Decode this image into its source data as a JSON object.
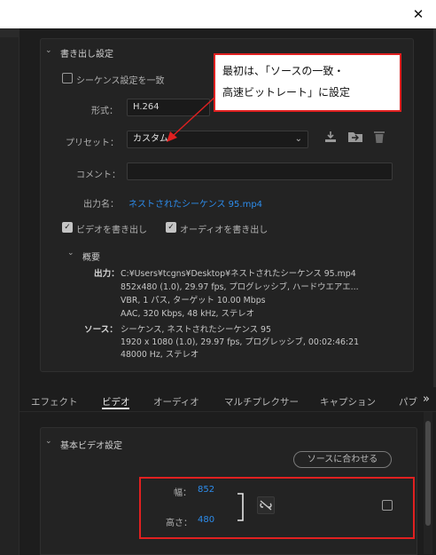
{
  "window": {
    "close_glyph": "✕"
  },
  "export": {
    "section_title": "書き出し設定",
    "match_sequence_label": "シーケンス設定を一致",
    "format_label": "形式：",
    "format_value": "H.264",
    "preset_label": "プリセット：",
    "preset_value": "カスタム",
    "comment_label": "コメント：",
    "comment_value": "",
    "output_name_label": "出力名：",
    "output_name_value": "ネストされたシーケンス 95.mp4",
    "export_video_label": "ビデオを書き出し",
    "export_audio_label": "オーディオを書き出し",
    "summary_title": "概要",
    "output_key": "出力：",
    "output_lines": [
      "C:¥Users¥tcgns¥Desktop¥ネストされたシーケンス 95.mp4",
      "852x480 (1.0), 29.97 fps, プログレッシブ, ハードウエアエ...",
      "VBR, 1 パス, ターゲット 10.00 Mbps",
      "AAC, 320 Kbps, 48 kHz, ステレオ"
    ],
    "source_key": "ソース：",
    "source_lines": [
      "シーケンス, ネストされたシーケンス 95",
      "1920 x 1080 (1.0), 29.97 fps, プログレッシブ, 00:02:46:21",
      "48000 Hz, ステレオ"
    ]
  },
  "callout": {
    "line1": "最初は、「ソースの一致・",
    "line2": "高速ビットレート」に設定"
  },
  "tabs": [
    "エフェクト",
    "ビデオ",
    "オーディオ",
    "マルチプレクサー",
    "キャプション",
    "パブ"
  ],
  "tabs_more_glyph": "»",
  "video": {
    "section_title": "基本ビデオ設定",
    "match_source_button": "ソースに合わせる",
    "width_label": "幅：",
    "width_value": "852",
    "height_label": "高さ：",
    "height_value": "480"
  },
  "icons": {
    "collapse": "chevron-down-icon",
    "preset_import": "download-icon",
    "preset_folder": "folder-icon",
    "preset_delete": "trash-icon",
    "link": "unlink-icon"
  },
  "colors": {
    "accent_link": "#2d8ceb",
    "highlight": "#e02020",
    "background": "#1d1d1d"
  }
}
